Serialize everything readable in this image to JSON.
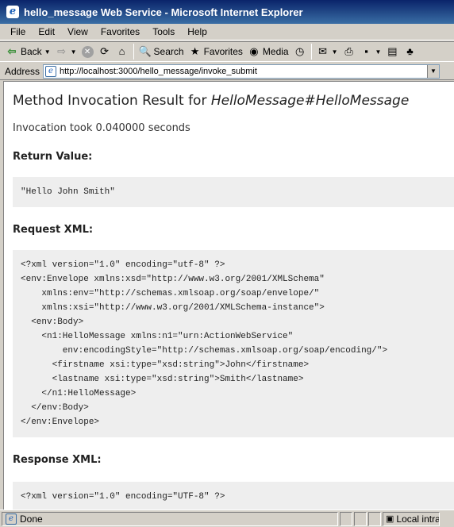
{
  "window": {
    "title": "hello_message Web Service - Microsoft Internet Explorer"
  },
  "menu": [
    "File",
    "Edit",
    "View",
    "Favorites",
    "Tools",
    "Help"
  ],
  "toolbar": {
    "back_label": "Back",
    "search_label": "Search",
    "favorites_label": "Favorites",
    "media_label": "Media"
  },
  "address": {
    "label": "Address",
    "url": "http://localhost:3000/hello_message/invoke_submit"
  },
  "page": {
    "heading_prefix": "Method Invocation Result for ",
    "heading_method": "HelloMessage#HelloMessage",
    "duration": "Invocation took 0.040000 seconds",
    "return_heading": "Return Value:",
    "return_value": "\"Hello John Smith\"",
    "request_heading": "Request XML:",
    "request_xml": "<?xml version=\"1.0\" encoding=\"utf-8\" ?>\n<env:Envelope xmlns:xsd=\"http://www.w3.org/2001/XMLSchema\"\n    xmlns:env=\"http://schemas.xmlsoap.org/soap/envelope/\"\n    xmlns:xsi=\"http://www.w3.org/2001/XMLSchema-instance\">\n  <env:Body>\n    <n1:HelloMessage xmlns:n1=\"urn:ActionWebService\"\n        env:encodingStyle=\"http://schemas.xmlsoap.org/soap/encoding/\">\n      <firstname xsi:type=\"xsd:string\">John</firstname>\n      <lastname xsi:type=\"xsd:string\">Smith</lastname>\n    </n1:HelloMessage>\n  </env:Body>\n</env:Envelope>",
    "response_heading": "Response XML:",
    "response_xml": "<?xml version=\"1.0\" encoding=\"UTF-8\" ?>"
  },
  "status": {
    "text": "Done",
    "zone": "Local intranet"
  }
}
